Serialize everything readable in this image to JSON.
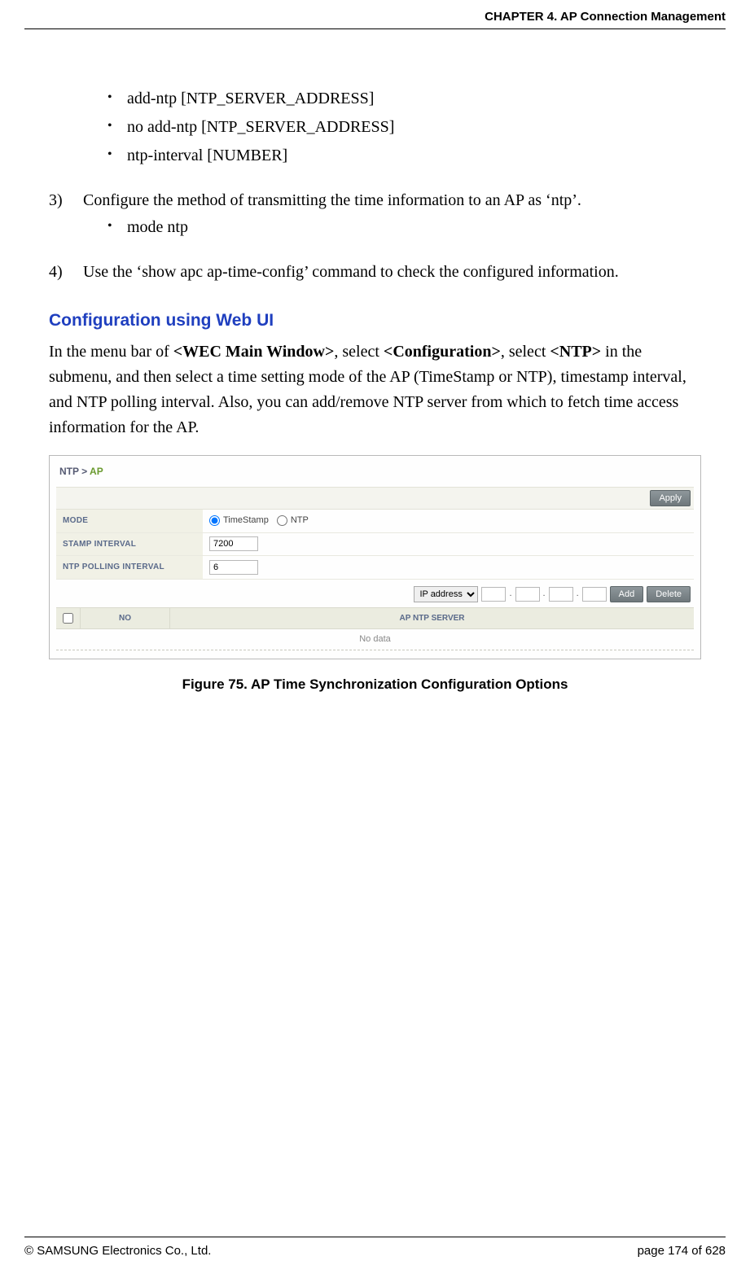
{
  "header": {
    "chapter": "CHAPTER 4. AP Connection Management"
  },
  "bullets_top": [
    "add-ntp [NTP_SERVER_ADDRESS]",
    "no add-ntp [NTP_SERVER_ADDRESS]",
    "ntp-interval [NUMBER]"
  ],
  "step3": {
    "num": "3)",
    "text": "Configure the method of transmitting the time information to an AP as ‘ntp’.",
    "sub": "mode ntp"
  },
  "step4": {
    "num": "4)",
    "text": "Use the ‘show apc ap-time-config’ command to check the configured information."
  },
  "section": {
    "title": "Configuration using Web UI",
    "p_pre": "In the menu bar of ",
    "p_b1": "<WEC Main Window>",
    "p_mid1": ", select ",
    "p_b2": "<Configuration>",
    "p_mid2": ", select ",
    "p_b3": "<NTP>",
    "p_post": " in the submenu, and then select a time setting mode of the AP (TimeStamp or NTP), timestamp interval, and NTP polling interval. Also, you can add/remove NTP server from which to fetch time access information for the AP."
  },
  "panel": {
    "bc_root": "NTP",
    "bc_sep": ">",
    "bc_leaf": "AP",
    "apply": "Apply",
    "labels": {
      "mode": "MODE",
      "stamp": "STAMP INTERVAL",
      "poll": "NTP POLLING INTERVAL"
    },
    "radios": {
      "ts": "TimeStamp",
      "ntp": "NTP"
    },
    "values": {
      "stamp": "7200",
      "poll": "6"
    },
    "ip_type": "IP address",
    "add": "Add",
    "del": "Delete",
    "th_no": "NO",
    "th_server": "AP NTP SERVER",
    "no_data": "No data"
  },
  "figure": "Figure 75. AP Time Synchronization Configuration Options",
  "footer": {
    "copyright": "© SAMSUNG Electronics Co., Ltd.",
    "page": "page 174 of 628"
  }
}
